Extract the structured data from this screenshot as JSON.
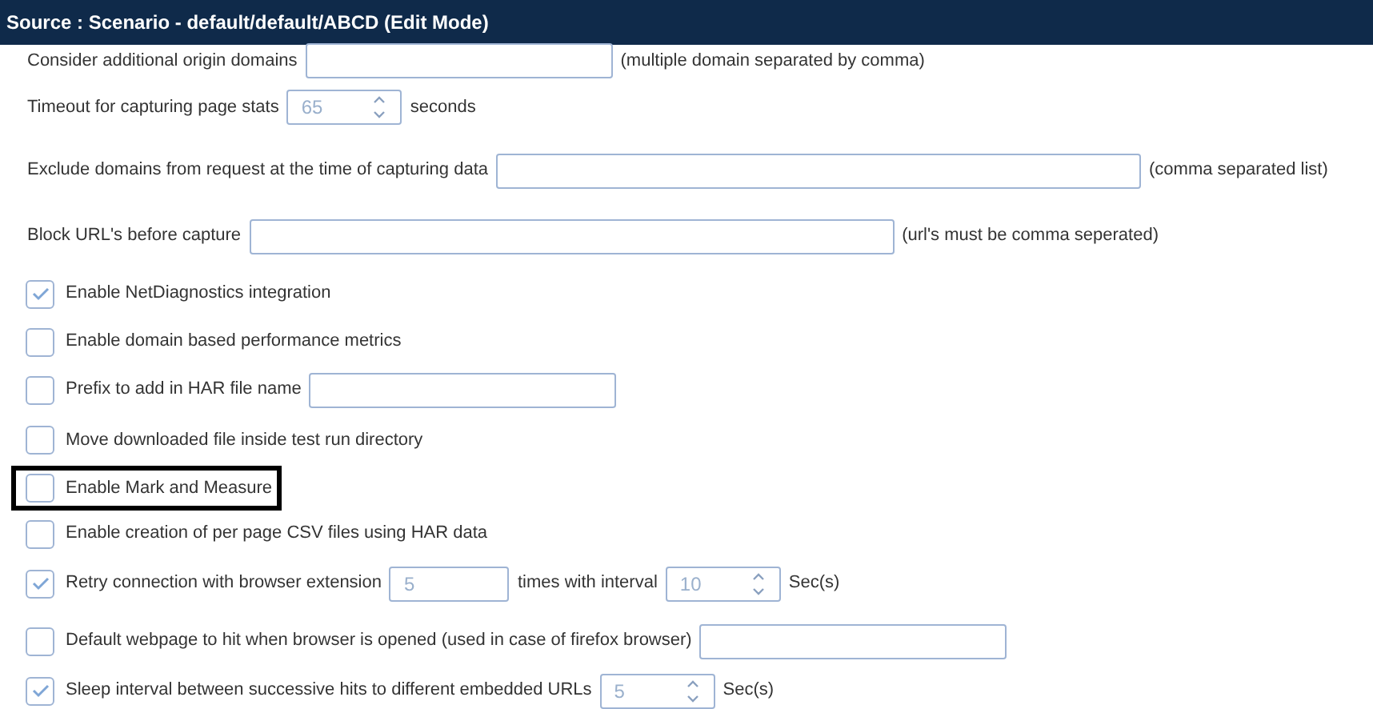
{
  "header": {
    "title": "Source : Scenario - default/default/ABCD (Edit Mode)"
  },
  "rows": [
    {
      "kind": "plain",
      "highlighted": false,
      "parts": [
        {
          "kind": "label",
          "text": "Consider additional origin domains"
        },
        {
          "kind": "text"
        },
        {
          "kind": "label",
          "text": "(multiple domain separated by comma)"
        }
      ]
    },
    {
      "kind": "plain",
      "highlighted": false,
      "parts": [
        {
          "kind": "label",
          "text": "Timeout for capturing page stats"
        },
        {
          "kind": "spinner",
          "value": "65"
        },
        {
          "kind": "label",
          "text": "seconds"
        }
      ]
    },
    {
      "kind": "plain",
      "highlighted": false,
      "parts": [
        {
          "kind": "label",
          "text": "Exclude domains from request at the time of capturing data"
        },
        {
          "kind": "long"
        },
        {
          "kind": "label",
          "text": "(comma separated list)"
        }
      ]
    },
    {
      "kind": "plain",
      "highlighted": false,
      "parts": [
        {
          "kind": "label",
          "text": "Block URL's before capture"
        },
        {
          "kind": "long"
        },
        {
          "kind": "label",
          "text": "(url's must be comma seperated)"
        }
      ]
    },
    {
      "kind": "checkbox",
      "checked": true,
      "highlighted": false,
      "parts": [
        {
          "kind": "label",
          "text": "Enable NetDiagnostics integration"
        }
      ]
    },
    {
      "kind": "checkbox",
      "checked": false,
      "highlighted": false,
      "parts": [
        {
          "kind": "label",
          "text": "Enable domain based performance metrics"
        }
      ]
    },
    {
      "kind": "checkbox",
      "checked": false,
      "highlighted": false,
      "parts": [
        {
          "kind": "label",
          "text": "Prefix to add in HAR file name"
        },
        {
          "kind": "text"
        }
      ]
    },
    {
      "kind": "checkbox",
      "checked": false,
      "highlighted": false,
      "parts": [
        {
          "kind": "label",
          "text": "Move downloaded file inside test run directory"
        }
      ]
    },
    {
      "kind": "checkbox",
      "checked": false,
      "highlighted": true,
      "parts": [
        {
          "kind": "label",
          "text": "Enable Mark and Measure"
        }
      ]
    },
    {
      "kind": "checkbox",
      "checked": false,
      "highlighted": false,
      "parts": [
        {
          "kind": "label",
          "text": "Enable creation of per page CSV files using HAR data"
        }
      ]
    },
    {
      "kind": "checkbox",
      "checked": true,
      "highlighted": false,
      "parts": [
        {
          "kind": "label",
          "text": "Retry connection with browser extension"
        },
        {
          "kind": "short",
          "value": "5"
        },
        {
          "kind": "label",
          "text": "times with interval"
        },
        {
          "kind": "spinner",
          "value": "10"
        },
        {
          "kind": "label",
          "text": "Sec(s)"
        }
      ]
    },
    {
      "kind": "checkbox",
      "checked": false,
      "highlighted": false,
      "parts": [
        {
          "kind": "label",
          "text": "Default webpage to hit when browser is opened (used in case of firefox browser)"
        },
        {
          "kind": "text"
        }
      ]
    },
    {
      "kind": "checkbox",
      "checked": true,
      "highlighted": false,
      "parts": [
        {
          "kind": "label",
          "text": "Sleep interval between successive hits to different embedded URLs"
        },
        {
          "kind": "spinner",
          "value": "5"
        },
        {
          "kind": "label",
          "text": "Sec(s)"
        }
      ]
    }
  ]
}
